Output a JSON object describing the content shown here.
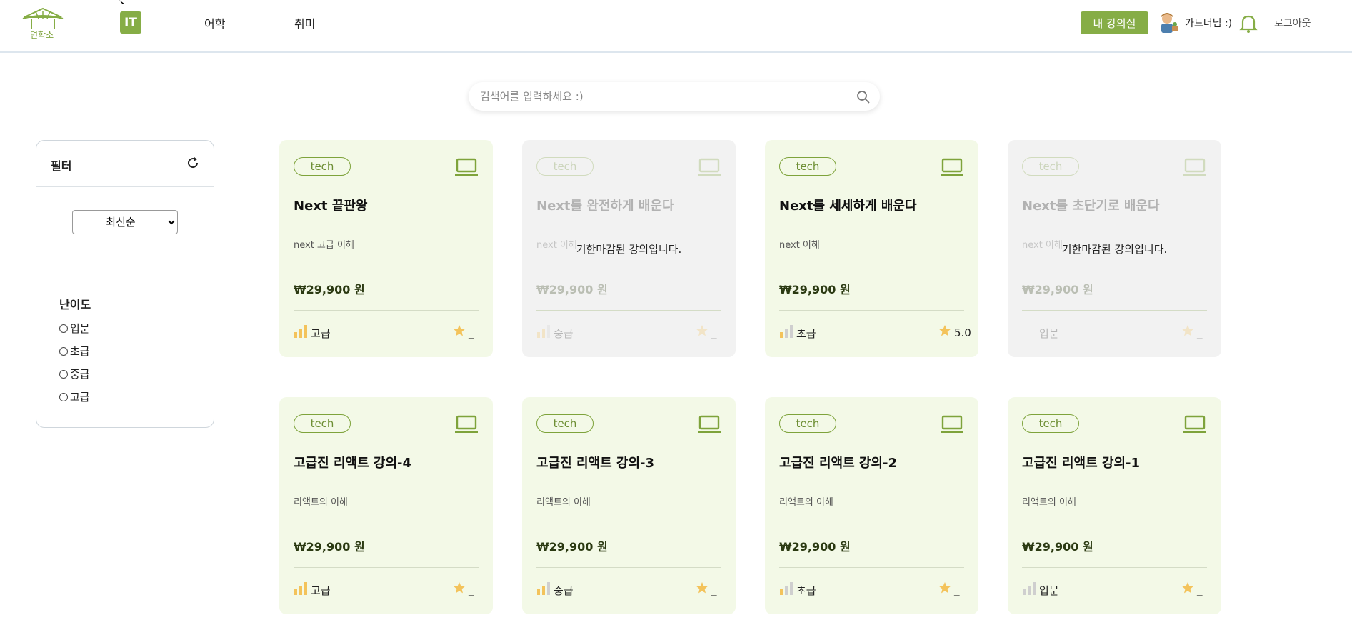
{
  "header": {
    "logo_text": "면학소",
    "nav": [
      {
        "label": "IT"
      },
      {
        "label": "어학"
      },
      {
        "label": "취미"
      }
    ],
    "my_class_label": "내 강의실",
    "user_name": "가드너님 :)",
    "logout_label": "로그아웃"
  },
  "search": {
    "placeholder": "검색어를 입력하세요 :)"
  },
  "filter": {
    "title": "필터",
    "sort_selected": "최신순",
    "level_title": "난이도",
    "levels": [
      "입문",
      "초급",
      "중급",
      "고급"
    ]
  },
  "colors": {
    "accent": "#86ad46",
    "card_bg": "#f3f9e7",
    "expired_bg": "#f2f2f2",
    "star": "#f3c35b"
  },
  "cards": [
    {
      "tag": "tech",
      "title": "Next 끝판왕",
      "desc": "next 고급 이해",
      "price": "₩29,900 원",
      "level": "고급",
      "rating": "_",
      "expired": false,
      "bars": 3
    },
    {
      "tag": "tech",
      "title": "Next를 완전하게 배운다",
      "desc": "next 이해",
      "price": "₩29,900 원",
      "level": "중급",
      "rating": "_",
      "expired": true,
      "expired_msg": "기한마감된 강의입니다.",
      "bars": 2
    },
    {
      "tag": "tech",
      "title": "Next를 세세하게 배운다",
      "desc": "next 이해",
      "price": "₩29,900 원",
      "level": "초급",
      "rating": "5.0",
      "expired": false,
      "bars": 1
    },
    {
      "tag": "tech",
      "title": "Next를 초단기로 배운다",
      "desc": "next 이해",
      "price": "₩29,900 원",
      "level": "입문",
      "rating": "_",
      "expired": true,
      "expired_msg": "기한마감된 강의입니다.",
      "bars": 0
    },
    {
      "tag": "tech",
      "title": "고급진 리액트 강의-4",
      "desc": "리액트의 이해",
      "price": "₩29,900 원",
      "level": "고급",
      "rating": "_",
      "expired": false,
      "bars": 3
    },
    {
      "tag": "tech",
      "title": "고급진 리액트 강의-3",
      "desc": "리액트의 이해",
      "price": "₩29,900 원",
      "level": "중급",
      "rating": "_",
      "expired": false,
      "bars": 2
    },
    {
      "tag": "tech",
      "title": "고급진 리액트 강의-2",
      "desc": "리액트의 이해",
      "price": "₩29,900 원",
      "level": "초급",
      "rating": "_",
      "expired": false,
      "bars": 1
    },
    {
      "tag": "tech",
      "title": "고급진 리액트 강의-1",
      "desc": "리액트의 이해",
      "price": "₩29,900 원",
      "level": "입문",
      "rating": "_",
      "expired": false,
      "bars": 0
    }
  ]
}
